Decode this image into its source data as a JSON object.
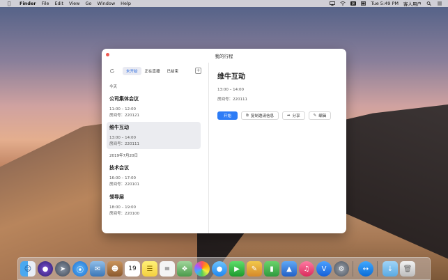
{
  "menubar": {
    "app": "Finder",
    "items": [
      "File",
      "Edit",
      "View",
      "Go",
      "Window",
      "Help"
    ],
    "clock": "Tue 5:49 PM",
    "user": "客人用户"
  },
  "window": {
    "title": "我的行程",
    "tabs": [
      "未开始",
      "正在直播",
      "已结束"
    ],
    "active_tab": "未开始",
    "sections": [
      {
        "label": "今天",
        "meetings": [
          {
            "title": "公司集体会议",
            "time": "11:00 – 12:00",
            "room": "房间号：220121"
          },
          {
            "title": "维牛互动",
            "time": "13:00 – 14:00",
            "room": "房间号：220111"
          }
        ]
      },
      {
        "label": "2019年7月20日",
        "meetings": [
          {
            "title": "技术会议",
            "time": "16:00 – 17:00",
            "room": "房间号：220101"
          },
          {
            "title": "领导层",
            "time": "18:00 – 19:00",
            "room": "房间号：220100"
          }
        ]
      }
    ],
    "detail": {
      "title": "维牛互动",
      "time": "13:00 – 14:00",
      "room": "房间号：220111",
      "buttons": {
        "start": "开始",
        "copy": "复制邀请信息",
        "share": "分享",
        "edit": "编辑"
      }
    }
  },
  "dock": {
    "calendar_day": "19"
  },
  "colors": {
    "accent": "#2d7cf6",
    "close": "#ee5a52",
    "selected_bg": "#ebecf0"
  }
}
